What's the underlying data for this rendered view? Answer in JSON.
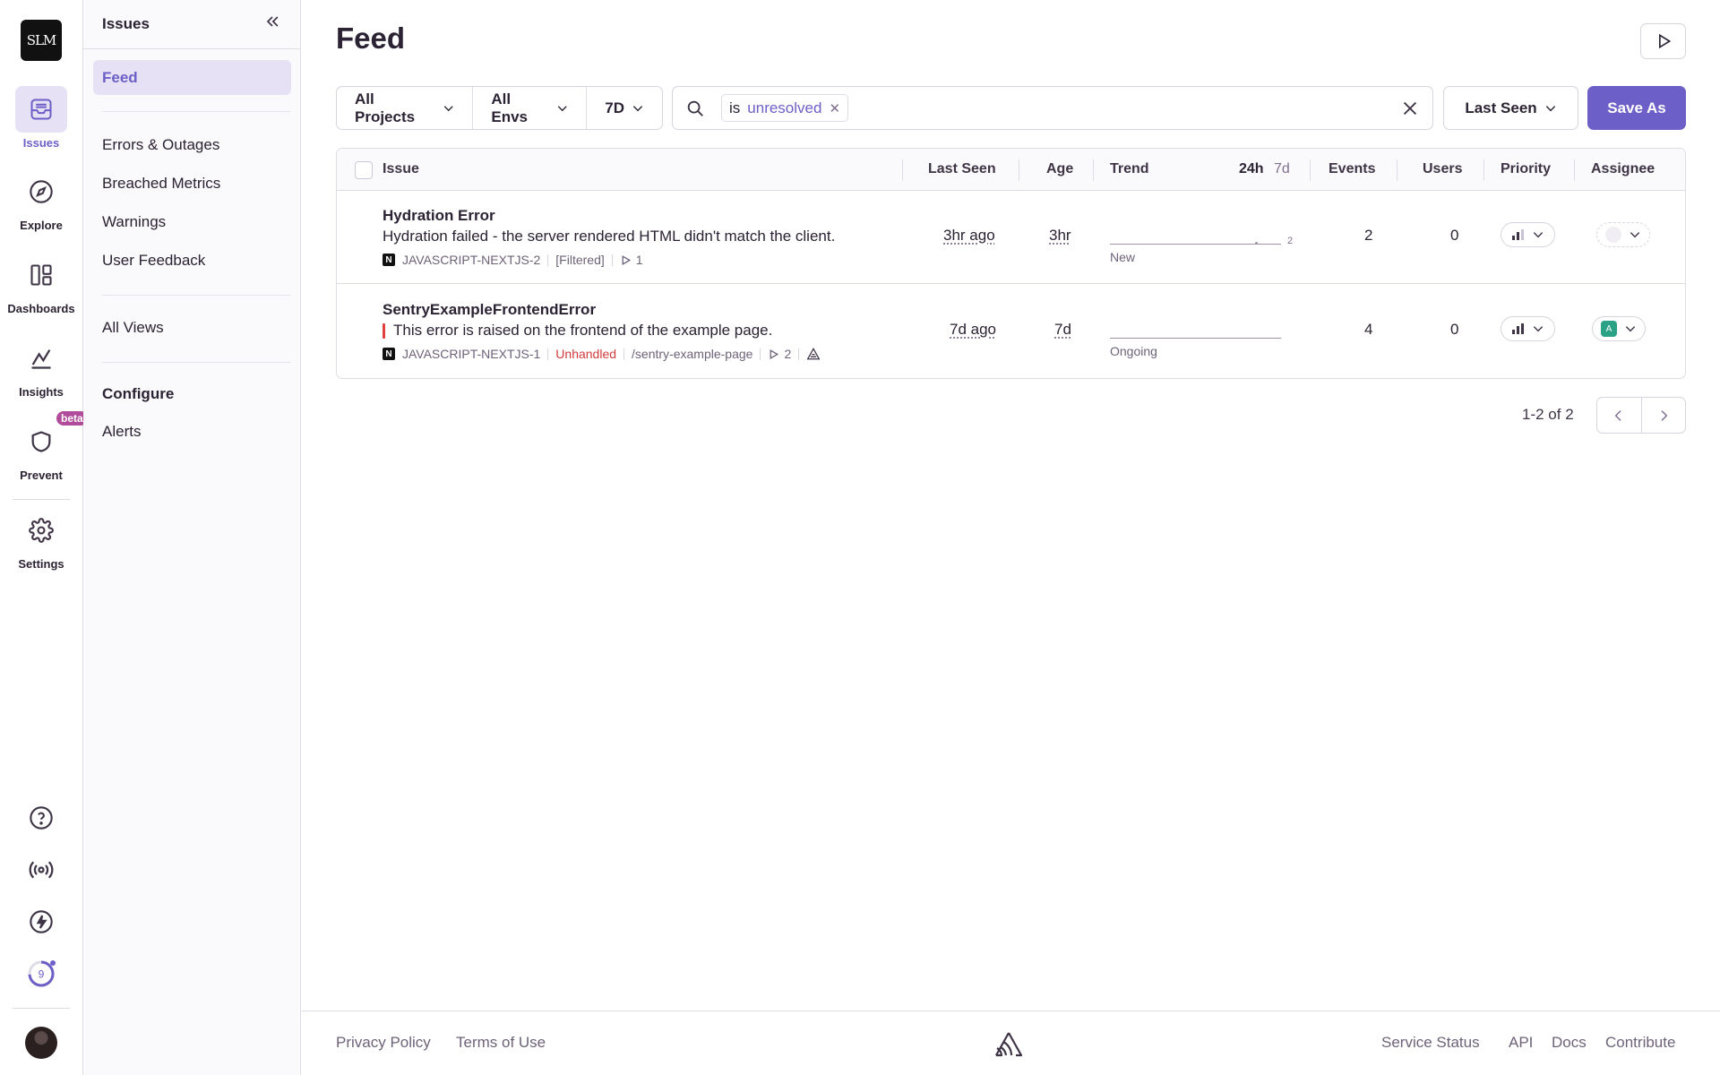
{
  "org": {
    "logo_text": "SLM"
  },
  "rail": {
    "items": [
      {
        "label": "Issues",
        "icon": "inbox-icon",
        "active": true
      },
      {
        "label": "Explore",
        "icon": "compass-icon"
      },
      {
        "label": "Dashboards",
        "icon": "dashboard-icon"
      },
      {
        "label": "Insights",
        "icon": "graph-icon"
      },
      {
        "label": "Prevent",
        "icon": "shield-icon",
        "badge": "beta"
      },
      {
        "label": "Settings",
        "icon": "gear-icon"
      }
    ],
    "bottom": {
      "help_icon": "question-circle-icon",
      "broadcast_icon": "broadcast-icon",
      "whats_new_icon": "lightning-icon",
      "onboarding_count": "9"
    }
  },
  "subnav": {
    "title": "Issues",
    "items": [
      "Feed",
      "Errors & Outages",
      "Breached Metrics",
      "Warnings",
      "User Feedback"
    ],
    "all_views": "All Views",
    "configure_heading": "Configure",
    "alerts": "Alerts"
  },
  "page": {
    "title": "Feed"
  },
  "filters": {
    "projects": "All Projects",
    "envs": "All Envs",
    "period": "7D"
  },
  "search": {
    "token_key": "is",
    "token_value": "unresolved"
  },
  "sort": {
    "label": "Last Seen"
  },
  "save_as": "Save As",
  "table": {
    "headers": {
      "issue": "Issue",
      "last_seen": "Last Seen",
      "age": "Age",
      "trend": "Trend",
      "trend_24h": "24h",
      "trend_7d": "7d",
      "events": "Events",
      "users": "Users",
      "priority": "Priority",
      "assignee": "Assignee"
    },
    "rows": [
      {
        "title": "Hydration Error",
        "message": "Hydration failed - the server rendered HTML didn't match the client.",
        "project": "JAVASCRIPT-NEXTJS-2",
        "tag": "[Filtered]",
        "replays": "1",
        "last_seen": "3hr ago",
        "age": "3hr",
        "trend_max": "2",
        "trend_label": "New",
        "events": "2",
        "users": "0",
        "assignee": ""
      },
      {
        "title": "SentryExampleFrontendError",
        "message": "This error is raised on the frontend of the example page.",
        "project": "JAVASCRIPT-NEXTJS-1",
        "tag": "Unhandled",
        "path": "/sentry-example-page",
        "replays": "2",
        "last_seen": "7d ago",
        "age": "7d",
        "trend_label": "Ongoing",
        "events": "4",
        "users": "0",
        "assignee": "A"
      }
    ]
  },
  "pagination": {
    "text": "1-2 of 2"
  },
  "footer": {
    "privacy": "Privacy Policy",
    "terms": "Terms of Use",
    "status": "Service Status",
    "api": "API",
    "docs": "Docs",
    "contribute": "Contribute"
  },
  "colors": {
    "accent": "#6c5fc7",
    "error_red": "#d33b3b",
    "assignee_green": "#2ba185"
  }
}
